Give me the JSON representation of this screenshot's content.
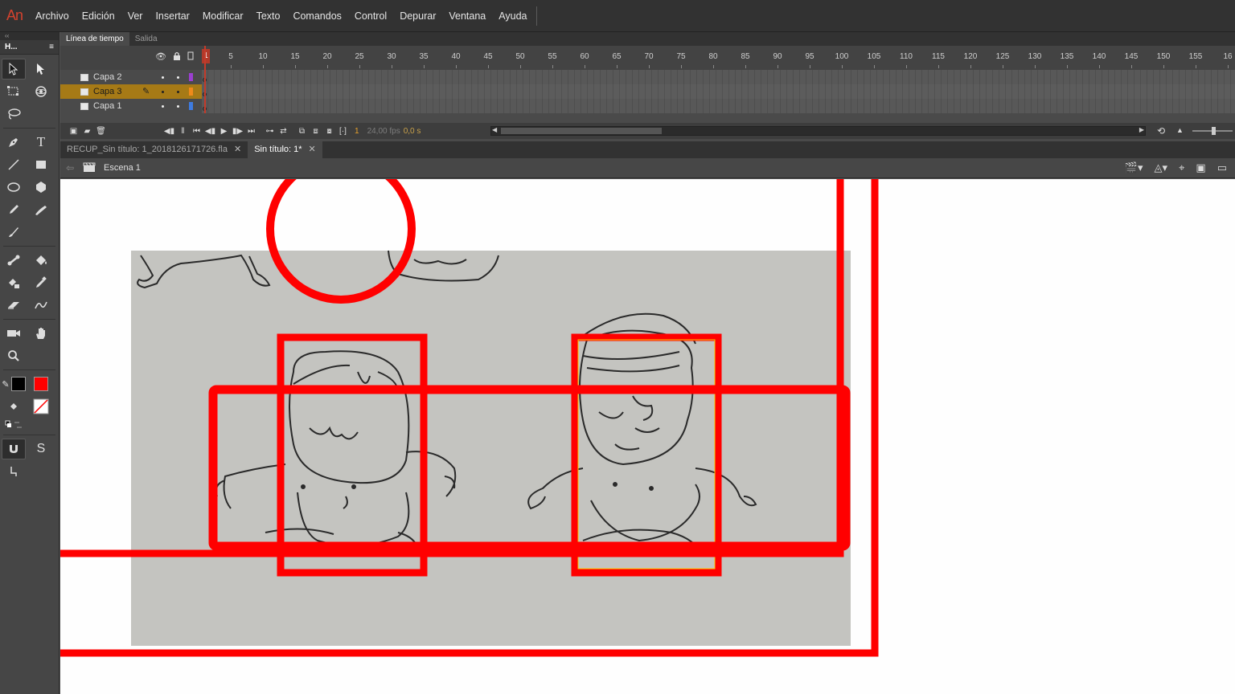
{
  "app": {
    "logo": "An"
  },
  "menu": [
    "Archivo",
    "Edición",
    "Ver",
    "Insertar",
    "Modificar",
    "Texto",
    "Comandos",
    "Control",
    "Depurar",
    "Ventana",
    "Ayuda"
  ],
  "tools_panel": {
    "title": "H..."
  },
  "timeline": {
    "tabs": [
      "Línea de tiempo",
      "Salida"
    ],
    "ruler": [
      "1",
      "5",
      "10",
      "15",
      "20",
      "25",
      "30",
      "35",
      "40",
      "45",
      "50",
      "55",
      "60",
      "65",
      "70",
      "75",
      "80",
      "85",
      "90",
      "95",
      "100",
      "105",
      "110",
      "115",
      "120",
      "125",
      "130",
      "135",
      "140",
      "145",
      "150",
      "155",
      "16"
    ],
    "current_frame": "1",
    "layers": [
      {
        "name": "Capa 2",
        "color": "#9b3fd1",
        "selected": false
      },
      {
        "name": "Capa 3",
        "color": "#f08a1a",
        "selected": true
      },
      {
        "name": "Capa 1",
        "color": "#3e7be0",
        "selected": false
      }
    ],
    "frame_display": "1",
    "fps": "24,00 fps",
    "time": "0,0 s"
  },
  "documents": [
    {
      "name": "RECUP_Sin título: 1_2018126171726.fla",
      "active": false
    },
    {
      "name": "Sin título: 1*",
      "active": true
    }
  ],
  "editbar": {
    "scene": "Escena 1"
  },
  "colors": {
    "stroke": "#000000",
    "fill": "#ff0000",
    "accent_red": "#ff0000",
    "layer_selected": "#a67a16"
  },
  "icons": [
    "selection-icon",
    "subselection-icon",
    "free-transform-icon",
    "3d-rotation-icon",
    "lasso-icon",
    "pen-icon",
    "text-icon",
    "line-icon",
    "rectangle-icon",
    "oval-icon",
    "polystar-icon",
    "pencil-icon",
    "brush-icon",
    "paint-brush-icon",
    "bone-icon",
    "paint-bucket-icon",
    "ink-bottle-icon",
    "eyedropper-icon",
    "eraser-icon",
    "width-icon",
    "camera-icon",
    "hand-icon",
    "zoom-icon",
    "snap-icon",
    "smooth-icon",
    "straighten-icon"
  ]
}
